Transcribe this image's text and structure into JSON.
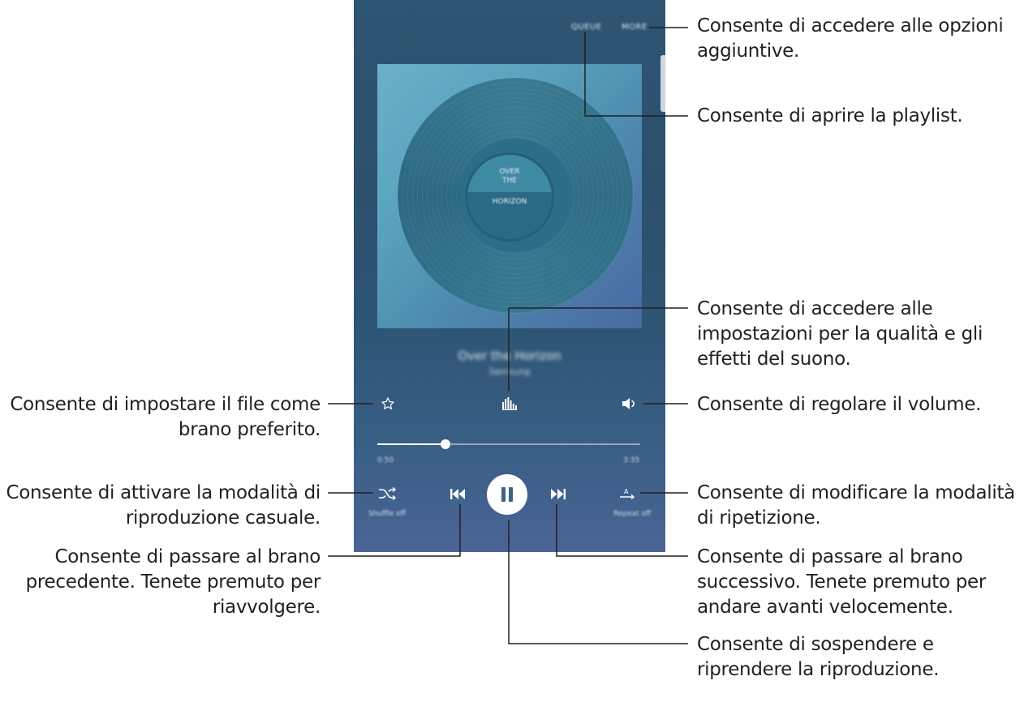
{
  "player": {
    "top_buttons": {
      "queue": "QUEUE",
      "more": "MORE"
    },
    "album_label": {
      "line1": "OVER",
      "line2": "THE",
      "line3": "HORIZON"
    },
    "song": {
      "title": "Over the Horizon",
      "artist": "Samsung"
    },
    "progress": {
      "elapsed": "0:50",
      "total": "3:35",
      "fraction": 0.26
    },
    "shuffle_caption": "Shuffle off",
    "repeat_caption": "Repeat off",
    "icons": {
      "favourite": "star-outline-icon",
      "soundalive": "equalizer-icon",
      "volume": "volume-icon",
      "shuffle": "shuffle-icon",
      "previous": "skip-previous-icon",
      "play_pause": "pause-icon",
      "next": "skip-next-icon",
      "repeat": "repeat-icon"
    },
    "colors": {
      "accent_white": "#ffffff",
      "pause_glyph": "#3d6387"
    }
  },
  "callouts": {
    "more": {
      "line1": "Consente di accedere alle opzioni",
      "line2": "aggiuntive."
    },
    "queue": {
      "line1": "Consente di aprire la playlist."
    },
    "soundalive": {
      "line1": "Consente di accedere alle",
      "line2": "impostazioni per la qualità e gli",
      "line3": "effetti del suono."
    },
    "volume": {
      "line1": "Consente di regolare il volume."
    },
    "repeat": {
      "line1": "Consente di modificare la modalità",
      "line2": "di ripetizione."
    },
    "next": {
      "line1": "Consente di passare al brano",
      "line2": "successivo. Tenete premuto per",
      "line3": "andare avanti velocemente."
    },
    "pause": {
      "line1": "Consente di sospendere e",
      "line2": "riprendere la riproduzione."
    },
    "favourite": {
      "line1": "Consente di impostare il file come",
      "line2": "brano preferito."
    },
    "shuffle": {
      "line1": "Consente di attivare la modalità di",
      "line2": "riproduzione casuale."
    },
    "previous": {
      "line1": "Consente di passare al brano",
      "line2": "precedente. Tenete premuto per",
      "line3": "riavvolgere."
    }
  }
}
